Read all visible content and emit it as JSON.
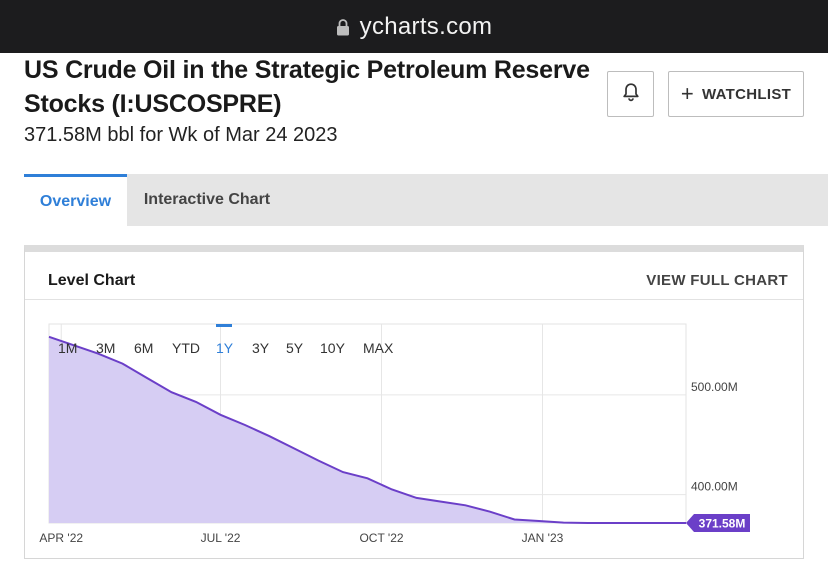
{
  "browser": {
    "url": "ycharts.com"
  },
  "header": {
    "title": "US Crude Oil in the Strategic Petroleum Reserve Stocks (I:USCOSPRE)",
    "subtitle": "371.58M bbl for Wk of Mar 24 2023",
    "watchlist_label": "WATCHLIST"
  },
  "tabs": [
    {
      "label": "Overview",
      "active": true
    },
    {
      "label": "Interactive Chart",
      "active": false
    }
  ],
  "card": {
    "title": "Level Chart",
    "link": "VIEW FULL CHART"
  },
  "ranges": [
    {
      "label": "1M",
      "active": false
    },
    {
      "label": "3M",
      "active": false
    },
    {
      "label": "6M",
      "active": false
    },
    {
      "label": "YTD",
      "active": false
    },
    {
      "label": "1Y",
      "active": true
    },
    {
      "label": "3Y",
      "active": false
    },
    {
      "label": "5Y",
      "active": false
    },
    {
      "label": "10Y",
      "active": false
    },
    {
      "label": "MAX",
      "active": false
    }
  ],
  "colors": {
    "accent": "#2f7fd8",
    "series_line": "#6b3fc8",
    "series_fill": "#d6cdf3",
    "value_badge": "#6b3fc8"
  },
  "chart_data": {
    "type": "area",
    "title": "",
    "xlabel": "",
    "ylabel": "",
    "x_ticks": [
      "APR '22",
      "JUL '22",
      "OCT '22",
      "JAN '23"
    ],
    "y_ticks": [
      "500.00M",
      "400.00M"
    ],
    "y_tick_values": [
      500,
      400
    ],
    "ylim": [
      371.58,
      558
    ],
    "xlim": [
      "2022-03-25",
      "2023-03-24"
    ],
    "grid": true,
    "last_value_label": "371.58M",
    "series": [
      {
        "name": "",
        "x": [
          "2022-03-25",
          "2022-04-08",
          "2022-04-22",
          "2022-05-06",
          "2022-05-20",
          "2022-06-03",
          "2022-06-17",
          "2022-07-01",
          "2022-07-15",
          "2022-07-29",
          "2022-08-12",
          "2022-08-26",
          "2022-09-09",
          "2022-09-23",
          "2022-10-07",
          "2022-10-21",
          "2022-11-04",
          "2022-11-18",
          "2022-12-02",
          "2022-12-16",
          "2022-12-30",
          "2023-01-13",
          "2023-01-27",
          "2023-02-10",
          "2023-02-24",
          "2023-03-10",
          "2023-03-24"
        ],
        "values": [
          558.1,
          549.7,
          541.3,
          531.3,
          516.9,
          502.6,
          492.9,
          480.0,
          469.8,
          458.5,
          446.3,
          434.1,
          422.6,
          416.4,
          405.1,
          396.7,
          393.0,
          389.3,
          382.9,
          375.1,
          373.6,
          372.0,
          371.6,
          371.6,
          371.6,
          371.6,
          371.58
        ]
      }
    ]
  }
}
